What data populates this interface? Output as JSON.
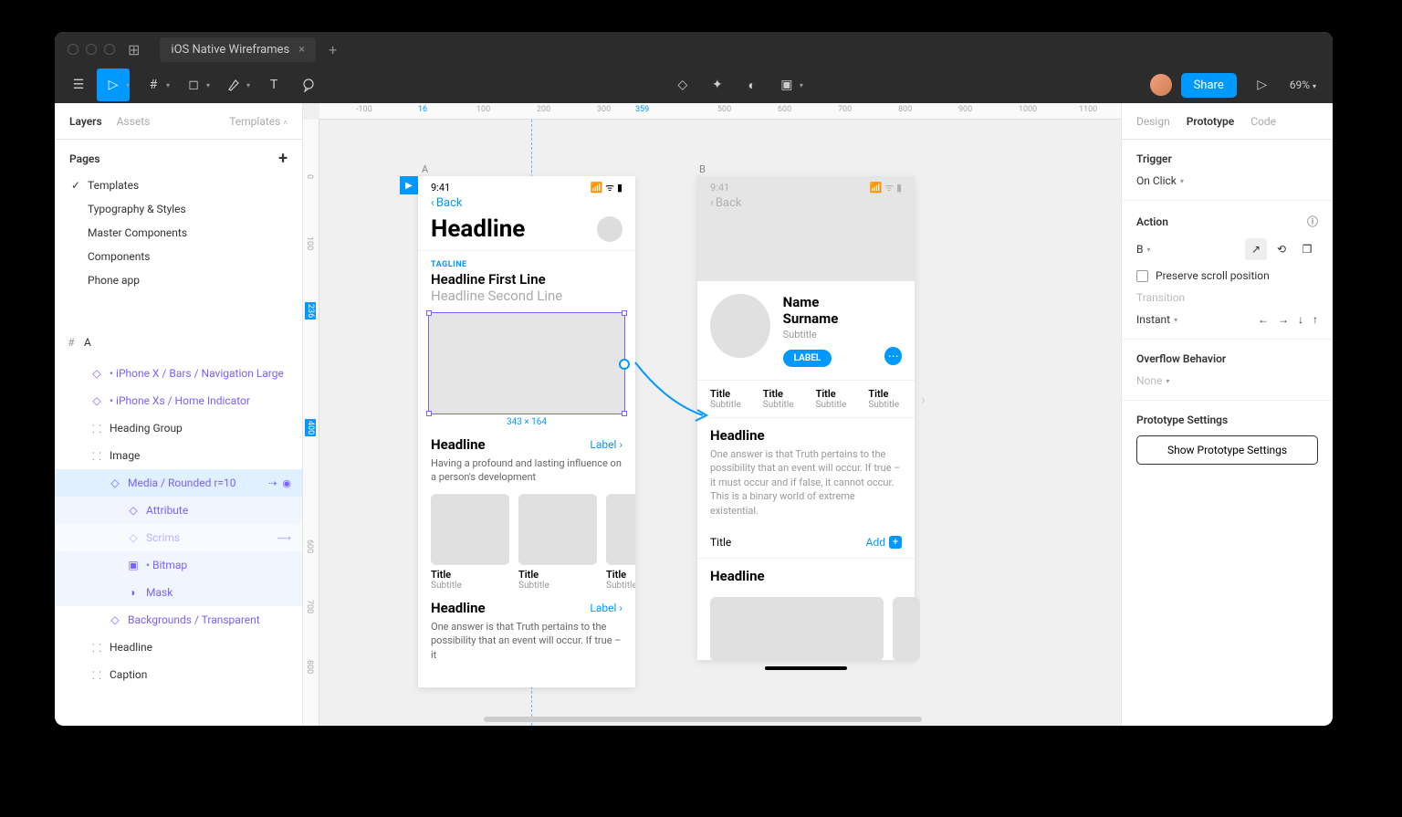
{
  "titlebar": {
    "tab_name": "iOS Native Wireframes"
  },
  "toolbar": {
    "share": "Share",
    "zoom": "69%"
  },
  "left": {
    "tabs": {
      "layers": "Layers",
      "assets": "Assets",
      "templates": "Templates"
    },
    "pages_label": "Pages",
    "pages": [
      "Templates",
      "Typography & Styles",
      "Master Components",
      "Components",
      "Phone app"
    ],
    "frame_label": "A",
    "layers": {
      "nav": "• iPhone X / Bars / Navigation Large",
      "home": "• iPhone Xs / Home Indicator",
      "heading": "Heading Group",
      "image": "Image",
      "media": "Media / Rounded r=10",
      "attribute": "Attribute",
      "scrims": "Scrims",
      "bitmap": "• Bitmap",
      "mask": "Mask",
      "bg": "Backgrounds / Transparent",
      "headline": "Headline",
      "caption": "Caption"
    }
  },
  "ruler": {
    "h": {
      "n100": "-100",
      "p16": "16",
      "p100": "100",
      "p200": "200",
      "p300": "300",
      "p359": "359",
      "p500": "500",
      "p600": "600",
      "p700": "700",
      "p800": "800",
      "p900": "900",
      "p1000": "1000",
      "p1100": "1100"
    },
    "v": {
      "p0": "0",
      "p100": "100",
      "p236": "236",
      "p400": "400",
      "p600": "600",
      "p700": "700",
      "p800": "800"
    }
  },
  "canvas": {
    "labelA": "A",
    "labelB": "B",
    "sel_dim": "343 × 164",
    "frameA": {
      "time": "9:41",
      "back": "Back",
      "headline": "Headline",
      "tagline": "TAGLINE",
      "first": "Headline First Line",
      "second": "Headline Second Line",
      "sec1_head": "Headline",
      "sec1_link": "Label",
      "body1": "Having a profound and lasting influence on a person's development",
      "card_title": "Title",
      "card_sub": "Subtitle",
      "sec2_head": "Headline",
      "sec2_link": "Label",
      "body2": "One answer is that Truth pertains to the possibility that an event will occur. If true – it"
    },
    "frameB": {
      "time": "9:41",
      "back": "Back",
      "name": "Name Surname",
      "subtitle": "Subtitle",
      "label": "LABEL",
      "tab_title": "Title",
      "tab_sub": "Subtitle",
      "sec_head": "Headline",
      "body": "One answer is that Truth pertains to the possibility that an event will occur. If true – it must occur and if false, it cannot occur. This is a binary world of extreme existential.",
      "add_title": "Title",
      "add_label": "Add",
      "sec2_head": "Headline"
    }
  },
  "right": {
    "tabs": {
      "design": "Design",
      "prototype": "Prototype",
      "code": "Code"
    },
    "trigger_label": "Trigger",
    "trigger_value": "On Click",
    "action_label": "Action",
    "action_value": "B",
    "preserve": "Preserve scroll position",
    "transition": "Transition",
    "instant": "Instant",
    "overflow_label": "Overflow Behavior",
    "overflow_value": "None",
    "proto_settings": "Prototype Settings",
    "proto_btn": "Show Prototype Settings"
  }
}
